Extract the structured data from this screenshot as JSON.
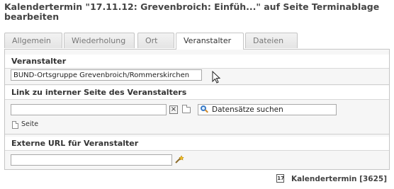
{
  "header": {
    "title": "Kalendertermin \"17.11.12: Grevenbroich: Einfüh...\" auf Seite Terminablage bearbeiten"
  },
  "tabs": [
    {
      "label": "Allgemein",
      "active": false
    },
    {
      "label": "Wiederholung",
      "active": false
    },
    {
      "label": "Ort",
      "active": false
    },
    {
      "label": "Veranstalter",
      "active": true
    },
    {
      "label": "Dateien",
      "active": false
    }
  ],
  "veranstalter": {
    "label": "Veranstalter",
    "value": "BUND-Ortsgruppe Grevenbroich/Rommerskirchen"
  },
  "link": {
    "label": "Link zu interner Seite des Veranstalters",
    "value": "",
    "clear_symbol": "×",
    "search_label": "Datensätze suchen",
    "page_label": "Seite"
  },
  "external_url": {
    "label": "Externe URL für Veranstalter",
    "value": ""
  },
  "footer": {
    "record_label": "Kalendertermin [3625]",
    "calendar_glyph": "17"
  },
  "colors": {
    "panel_bg": "#f6f6f6",
    "border": "#c5c5c5",
    "search_icon": "#3a7bc8"
  }
}
